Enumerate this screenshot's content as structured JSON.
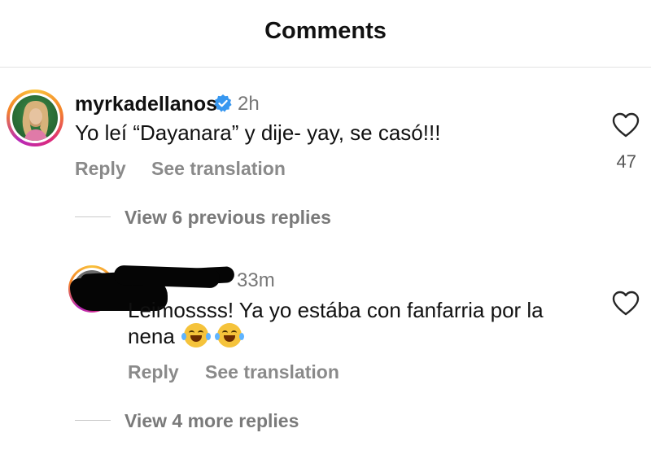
{
  "header": {
    "title": "Comments"
  },
  "comments": [
    {
      "username": "myrkadellanos",
      "verified": true,
      "time": "2h",
      "text": "Yo leí “Dayanara” y dije- yay, se casó!!!",
      "reply_label": "Reply",
      "translate_label": "See translation",
      "likes": "47",
      "view_replies": "View 6 previous replies"
    },
    {
      "time": "33m",
      "text_line1": "Leimossss! Ya yo estába con fanfarria por la",
      "text_line2": "nena",
      "emoji": [
        "face-with-tears-of-joy",
        "face-with-tears-of-joy"
      ],
      "reply_label": "Reply",
      "translate_label": "See translation",
      "view_replies": "View 4 more replies"
    }
  ],
  "colors": {
    "verified": "#3797f0",
    "text": "#111111",
    "secondary": "#8a8a8a"
  }
}
